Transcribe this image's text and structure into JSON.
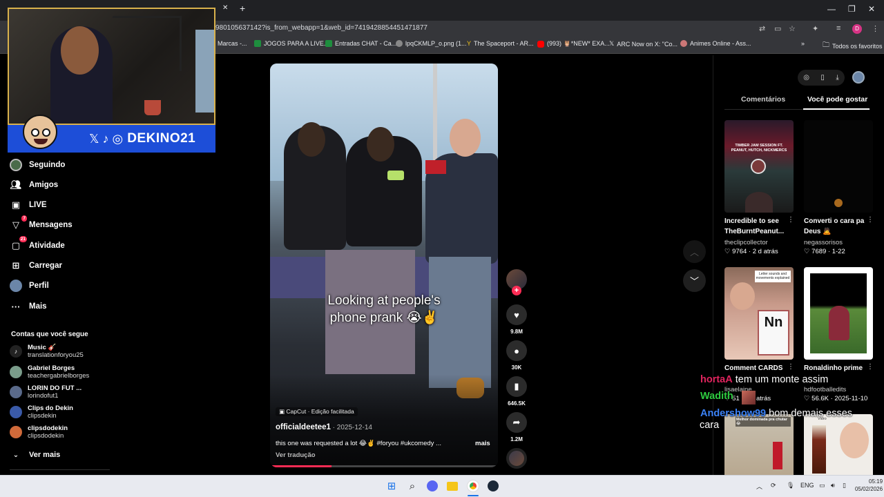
{
  "browser": {
    "url": "980105637142?is_from_webapp=1&web_id=7419428854451471877",
    "bookmarks": [
      "Marcas -...",
      "JOGOS PARA A LIVE...",
      "Entradas CHAT - Ca...",
      "lpqCKMLP_o.png (1...",
      "The Spaceport - AR...",
      "(993) 🦉*NEW* EXA...",
      "ARC Now on X: \"Co...",
      "Animes Online - Ass...",
      "Todos os favoritos"
    ],
    "new_tab": "+",
    "close_tab": "✕",
    "controls": {
      "min": "—",
      "max": "❐",
      "close": "✕"
    }
  },
  "webcam": {
    "overlay_text": "DEKINO21"
  },
  "sidebar": {
    "items": [
      {
        "label": "Seguindo",
        "icon": "following-avatar-icon"
      },
      {
        "label": "Amigos",
        "icon": "friends-icon"
      },
      {
        "label": "LIVE",
        "icon": "live-icon"
      },
      {
        "label": "Mensagens",
        "icon": "messages-icon",
        "badge": "7"
      },
      {
        "label": "Atividade",
        "icon": "activity-icon",
        "badge": "21"
      },
      {
        "label": "Carregar",
        "icon": "upload-icon"
      },
      {
        "label": "Perfil",
        "icon": "profile-icon"
      },
      {
        "label": "Mais",
        "icon": "more-icon"
      }
    ],
    "following_title": "Contas que você segue",
    "accounts": [
      {
        "name": "Music 🎸",
        "handle": "translationforyou25"
      },
      {
        "name": "Gabriel Borges",
        "handle": "teachergabrielborges"
      },
      {
        "name": "LORIN DO FUT ...",
        "handle": "lorindofut1"
      },
      {
        "name": "Clips do Dekin",
        "handle": "clipsdekin"
      },
      {
        "name": "clipsdodekin",
        "handle": "clipsdodekin"
      }
    ],
    "see_more": "Ver mais"
  },
  "video": {
    "caption_line1": "Looking at people's",
    "caption_line2": "phone prank 😭✌️",
    "capcut": "CapCut · Edição facilitada",
    "author": "officialdeetee1",
    "date": " · 2025-12-14",
    "description": "this one was requested a lot 😂✌️ #foryou #ukcomedy ...",
    "more": "mais",
    "translate": "Ver tradução",
    "progress": 0.27
  },
  "actions": {
    "likes": "9.8M",
    "comments": "30K",
    "saves": "646.5K",
    "shares": "1.2M"
  },
  "right_panel": {
    "tabs": [
      "Comentários",
      "Você pode gostar"
    ],
    "active_tab": 1,
    "cards": [
      {
        "title": "Incredible to see TheBurntPeanut...",
        "title2": "TheBurntPeanut...",
        "title1": "Incredible to see",
        "author": "theclipcollector",
        "meta": "♡ 9764 · 2 d atrás",
        "thumb_text": "TIMBER JAM SESSION FT. PEANUT, HUTCH, NICKMERCS"
      },
      {
        "title1": "Converti o cara pa",
        "title2": "Deus 🙇",
        "author": "negassorisos",
        "meta": "♡ 7689 · 1-22",
        "thumb_text": ""
      },
      {
        "title1": "Comment CARDS",
        "title2": "",
        "author": "lisaelaine",
        "meta": "♡ 51 · 3 d atrás",
        "thumb_text": "Letter sounds and movements explained"
      },
      {
        "title1": "Ronaldinho prime",
        "title2": "",
        "author": "hdfootballedits",
        "meta": "♡ 56.6K · 2025-11-10",
        "thumb_text": ""
      },
      {
        "title1": "",
        "title2": "",
        "author": "",
        "meta": "",
        "thumb_text": "Melhor dominada pra chutar😂"
      },
      {
        "title1": "",
        "title2": "",
        "author": "",
        "meta": "",
        "thumb_text": "Vidro"
      }
    ]
  },
  "chat": [
    {
      "user": "hortaA",
      "message": "tem um monte assim",
      "color": "#e0245e"
    },
    {
      "user": "Wadith",
      "message": "",
      "color": "#2ecc40"
    },
    {
      "user": "Andershow99",
      "message": "bom demais esses",
      "message2": "cara",
      "color": "#3b82f6"
    }
  ],
  "taskbar": {
    "lang": "ENG",
    "time": "05:19",
    "date": "05/02/2026"
  }
}
